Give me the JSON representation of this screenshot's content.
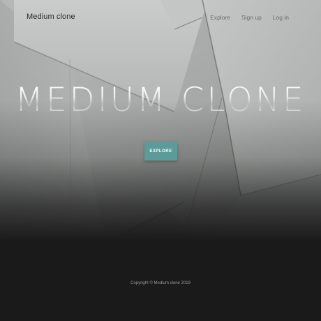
{
  "navbar": {
    "brand": "Medium clone",
    "links": [
      {
        "label": "Explore"
      },
      {
        "label": "Sign up"
      },
      {
        "label": "Log in"
      }
    ]
  },
  "hero": {
    "title": "MEDIUM CLONE",
    "button_label": "EXPLORE",
    "background": "abstract-grey-paper-shapes"
  },
  "footer": {
    "copyright": "Copyright © Medium clone 2019"
  },
  "colors": {
    "accent": "#5d9b9a",
    "footer_bg": "#1a1a1a",
    "hero_bg": "#a9acaa"
  }
}
